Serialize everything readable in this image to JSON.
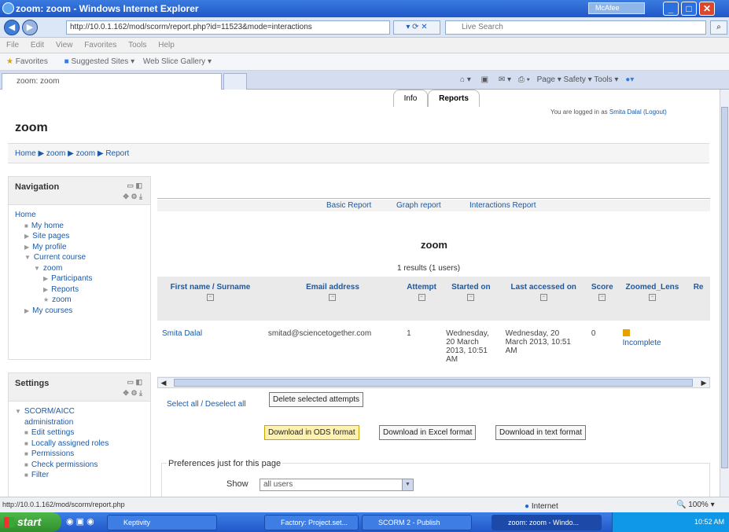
{
  "window": {
    "title": "zoom: zoom - Windows Internet Explorer",
    "mcafee": "McAfee"
  },
  "browser": {
    "address": "http://10.0.1.162/mod/scorm/report.php?id=11523&mode=interactions",
    "search_placeholder": "Live Search",
    "menu": [
      "File",
      "Edit",
      "View",
      "Favorites",
      "Tools",
      "Help"
    ],
    "favorites_label": "Favorites",
    "suggested_sites": "Suggested Sites ▾",
    "web_slice": "Web Slice Gallery ▾",
    "tab_title": "zoom: zoom",
    "commands": "Page ▾  Safety ▾  Tools ▾"
  },
  "page": {
    "title": "zoom",
    "logged_in_prefix": "You are logged in as ",
    "logged_in_user": "Smita Dalal",
    "logout": "(Logout)",
    "breadcrumb": "Home ▶ zoom ▶ zoom ▶ Report"
  },
  "navigation": {
    "title": "Navigation",
    "items": [
      {
        "label": "Home",
        "indent": 0,
        "marker": ""
      },
      {
        "label": "My home",
        "indent": 1,
        "marker": "■"
      },
      {
        "label": "Site pages",
        "indent": 1,
        "marker": "▶"
      },
      {
        "label": "My profile",
        "indent": 1,
        "marker": "▶"
      },
      {
        "label": "Current course",
        "indent": 1,
        "marker": "▼"
      },
      {
        "label": "zoom",
        "indent": 2,
        "marker": "▼"
      },
      {
        "label": "Participants",
        "indent": 3,
        "marker": "▶"
      },
      {
        "label": "Reports",
        "indent": 3,
        "marker": "▶"
      },
      {
        "label": "zoom",
        "indent": 3,
        "marker": "★"
      },
      {
        "label": "My courses",
        "indent": 1,
        "marker": "▶"
      }
    ]
  },
  "settings": {
    "title": "Settings",
    "items": [
      {
        "label": "SCORM/AICC",
        "indent": 0,
        "marker": "▼"
      },
      {
        "label": "administration",
        "indent": 1,
        "marker": ""
      },
      {
        "label": "Edit settings",
        "indent": 1,
        "marker": "■"
      },
      {
        "label": "Locally assigned roles",
        "indent": 1,
        "marker": "■"
      },
      {
        "label": "Permissions",
        "indent": 1,
        "marker": "■"
      },
      {
        "label": "Check permissions",
        "indent": 1,
        "marker": "■"
      },
      {
        "label": "Filter",
        "indent": 1,
        "marker": "■"
      }
    ]
  },
  "report": {
    "tabs": [
      "Info",
      "Reports"
    ],
    "subnav": [
      "Basic Report",
      "Graph report",
      "Interactions Report"
    ],
    "heading": "zoom",
    "results": "1 results (1 users)",
    "columns": [
      "First name / Surname",
      "Email address",
      "Attempt",
      "Started on",
      "Last accessed on",
      "Score",
      "Zoomed_Lens",
      "Re"
    ],
    "row": {
      "name": "Smita Dalal",
      "email": "smitad@sciencetogether.com",
      "attempt": "1",
      "started": "Wednesday, 20 March 2013, 10:51 AM",
      "last": "Wednesday, 20 March 2013, 10:51 AM",
      "score": "0",
      "zoomed": "Incomplete"
    },
    "select_all": "Select all / Deselect all",
    "delete_btn": "Delete selected attempts",
    "download_ods": "Download in ODS format",
    "download_excel": "Download in Excel format",
    "download_text": "Download in text format",
    "prefs_legend": "Preferences just for this page",
    "show_label": "Show",
    "show_value": "all users"
  },
  "status": {
    "url": "http://10.0.1.162/mod/scorm/report.php",
    "zone": "Internet",
    "zoom": "100%"
  },
  "taskbar": {
    "start": "start",
    "tasks": [
      "Keptivity",
      "Factory: Project.set...",
      "SCORM 2 - Publish",
      "zoom: zoom - Windo..."
    ],
    "clock": "10:52 AM"
  }
}
